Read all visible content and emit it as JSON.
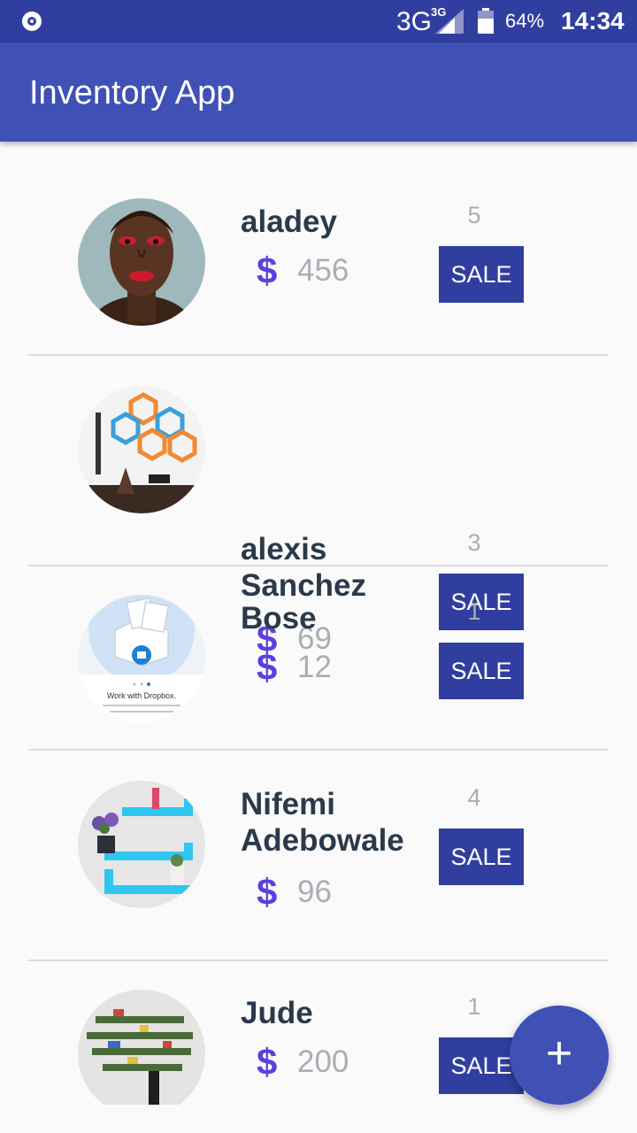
{
  "status_bar": {
    "network": "3G",
    "network_small": "3G",
    "battery": "64%",
    "time": "14:34",
    "left_icon": "record-icon",
    "signal_icon": "signal-icon",
    "battery_icon": "battery-icon"
  },
  "app_bar": {
    "title": "Inventory App"
  },
  "currency_symbol": "$",
  "sale_label": "SALE",
  "products": [
    {
      "name": "aladey",
      "price": "456",
      "quantity": "5",
      "thumb": "portrait"
    },
    {
      "name": "alexis Sanchez",
      "price": "69",
      "quantity": "3",
      "thumb": "hex-shelves"
    },
    {
      "name": "Bose",
      "price": "12",
      "quantity": "1",
      "thumb": "dropbox-screen",
      "thumb_caption": "Work with Dropbox."
    },
    {
      "name": "Nifemi Adebowale",
      "price": "96",
      "quantity": "4",
      "thumb": "blue-shelves"
    },
    {
      "name": "Jude",
      "price": "200",
      "quantity": "1",
      "thumb": "tree-shelf"
    }
  ],
  "fab": {
    "icon": "add-icon",
    "label": "+"
  },
  "colors": {
    "status_bar": "#303f9f",
    "app_bar": "#3f51b5",
    "sale_button": "#303f9f",
    "currency": "#5b3fe0",
    "name_text": "#2b3a4a",
    "muted_text": "#a9aeb4"
  }
}
